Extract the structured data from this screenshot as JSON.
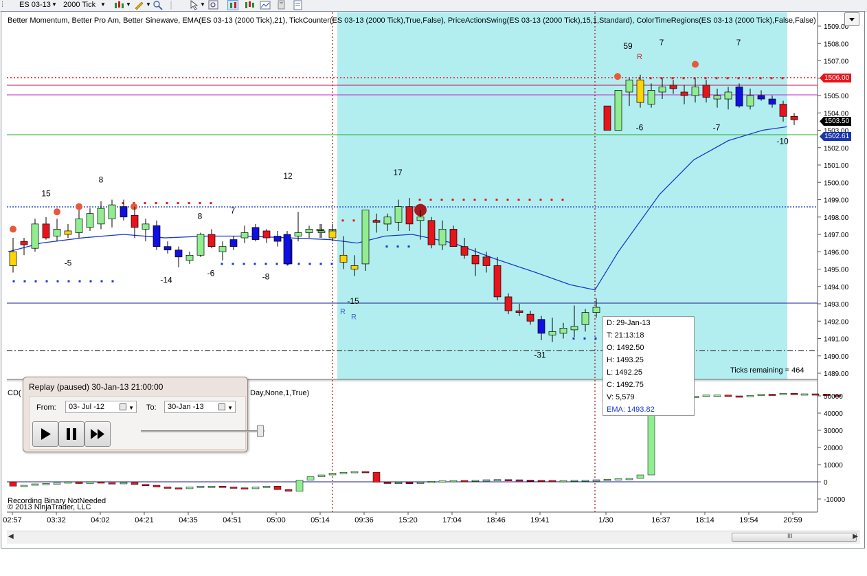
{
  "toolbar": {
    "instrument": "ES 03-13",
    "interval": "2000 Tick"
  },
  "indicators_text": "Better Momentum, Better Pro Am, Better Sinewave, EMA(ES 03-13 (2000 Tick),21), TickCounter(ES 03-13 (2000 Tick),True,False), PriceActionSwing(ES 03-13 (2000 Tick),15,1,Standard), ColorTimeRegions(ES 03-13 (2000 Tick),False,False)",
  "price_axis": {
    "ticks": [
      "1509.00",
      "1508.00",
      "1507.00",
      "1506.00",
      "1505.00",
      "1504.00",
      "1503.00",
      "1502.00",
      "1501.00",
      "1500.00",
      "1499.00",
      "1498.00",
      "1497.00",
      "1496.00",
      "1495.00",
      "1494.00",
      "1493.00",
      "1492.00",
      "1491.00",
      "1490.00",
      "1489.00"
    ],
    "tags": {
      "high_line": "1506.00",
      "last_price": "1503.50",
      "ema": "1502.61"
    }
  },
  "lower_axis": {
    "ticks": [
      "50000",
      "40000",
      "30000",
      "20000",
      "10000",
      "0",
      "-10000"
    ]
  },
  "lower_panel_label": "CD(",
  "lower_panel_label2": "Day,None,1,True)",
  "time_axis": [
    "02:57",
    "03:32",
    "04:02",
    "04:21",
    "04:35",
    "04:51",
    "05:00",
    "05:14",
    "09:36",
    "15:20",
    "17:04",
    "18:46",
    "19:41",
    "1/30",
    "16:37",
    "18:14",
    "19:54",
    "20:59"
  ],
  "swing_labels": {
    "top": [
      "15",
      "8",
      "8",
      "7",
      "12",
      "17",
      "59",
      "7",
      "7"
    ],
    "bottom": [
      "-5",
      "-14",
      "-6",
      "-8",
      "-15",
      "-31",
      "-6",
      "-7",
      "-10"
    ],
    "markers": [
      "R",
      "R",
      "R"
    ]
  },
  "ticks_remaining": "Ticks remaining = 464",
  "recording_text": "Recording Binary NotNeeded",
  "copyright_text": "© 2013 NinjaTrader, LLC",
  "tooltip": {
    "date": "D: 29-Jan-13",
    "time": "T: 21:13:18",
    "open": "O: 1492.50",
    "high": "H: 1493.25",
    "low": "L: 1492.25",
    "close": "C: 1492.75",
    "volume": "V: 5,579",
    "ema": "EMA: 1493.82"
  },
  "replay": {
    "title": "Replay (paused) 30-Jan-13 21:00:00",
    "from_label": "From:",
    "from_value": "03- Jul -12",
    "to_label": "To:",
    "to_value": "30-Jan -13",
    "play_icon": "play-icon",
    "pause_icon": "pause-icon",
    "fast_forward_icon": "fast-forward-icon"
  },
  "scroll_grip": "III",
  "colors": {
    "up_candle": "#90ee90",
    "down_candle": "#e8141c",
    "ema_line": "#1a3bc8",
    "session_region": "#b2eef0",
    "swing_high_dots": "#e8141c",
    "swing_low_dots": "#1a36c8",
    "price_tag_red": "#e8141c",
    "price_tag_black": "#000000",
    "price_tag_blue": "#1a36a8"
  }
}
